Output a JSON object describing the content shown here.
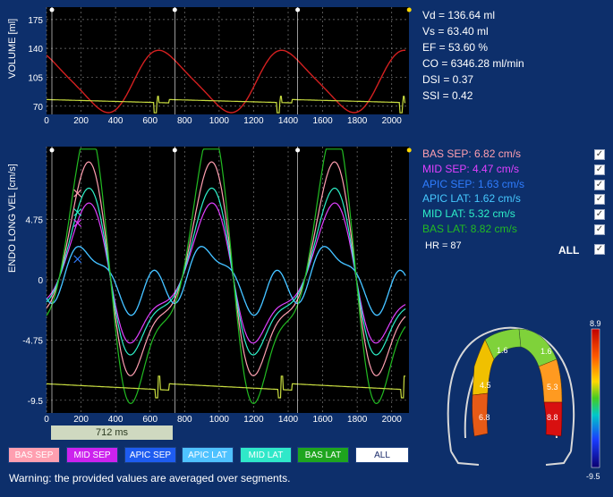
{
  "volume_panel": {
    "ylabel": "VOLUME [ml]",
    "y_ticks": [
      "175",
      "140",
      "105",
      "70"
    ],
    "x_ticks": [
      "0",
      "200",
      "400",
      "600",
      "800",
      "1000",
      "1200",
      "1400",
      "1600",
      "1800",
      "2000"
    ]
  },
  "velocity_panel": {
    "ylabel": "ENDO LONG VEL [cm/s]",
    "y_ticks": [
      "4.75",
      "0",
      "-4.75",
      "-9.5"
    ],
    "x_ticks": [
      "0",
      "200",
      "400",
      "600",
      "800",
      "1000",
      "1200",
      "1400",
      "1600",
      "1800",
      "2000"
    ],
    "duration_label": "712 ms"
  },
  "stats": {
    "vd": "Vd = 136.64 ml",
    "vs": "Vs = 63.40 ml",
    "ef": "EF = 53.60 %",
    "co": "CO = 6346.28 ml/min",
    "dsi": "DSI = 0.37",
    "ssi": "SSI = 0.42"
  },
  "segments": [
    {
      "label": "BAS SEP: 6.82  cm/s",
      "color": "#ff9fb0",
      "btn": "BAS SEP",
      "btn_bg": "#ff9fb0",
      "btn_fg": "#ffffff"
    },
    {
      "label": "MID SEP: 4.47  cm/s",
      "color": "#e040ff",
      "btn": "MID SEP",
      "btn_bg": "#cc22ee",
      "btn_fg": "#ffffff"
    },
    {
      "label": "APIC SEP: 1.63  cm/s",
      "color": "#2f7dff",
      "btn": "APIC SEP",
      "btn_bg": "#1e5cf0",
      "btn_fg": "#ffffff"
    },
    {
      "label": "APIC LAT: 1.62  cm/s",
      "color": "#46c8ff",
      "btn": "APIC LAT",
      "btn_bg": "#4fc2ff",
      "btn_fg": "#ffffff"
    },
    {
      "label": "MID LAT: 5.32  cm/s",
      "color": "#2ef0c8",
      "btn": "MID LAT",
      "btn_bg": "#2fe8c9",
      "btn_fg": "#ffffff"
    },
    {
      "label": "BAS LAT: 8.82  cm/s",
      "color": "#22bb22",
      "btn": "BAS LAT",
      "btn_bg": "#1ea51e",
      "btn_fg": "#ffffff"
    }
  ],
  "all_button": "ALL",
  "hr": "HR = 87",
  "all_toggle_label": "ALL",
  "color_scale": {
    "max": "8.9",
    "min": "-9.5"
  },
  "heart_values": {
    "apic_sep": "1.6",
    "apic_lat": "1.6",
    "mid_sep": "4.5",
    "mid_lat": "5.3",
    "bas_sep": "6.8",
    "bas_lat": "8.8"
  },
  "warning": "Warning: the provided values are averaged over segments.",
  "chart_data": [
    {
      "type": "line",
      "ylabel": "VOLUME [ml]",
      "xlim": [
        0,
        2100
      ],
      "ylim": [
        60,
        190
      ],
      "y_ticks": [
        70,
        105,
        140,
        175
      ],
      "x_ticks": [
        0,
        200,
        400,
        600,
        800,
        1000,
        1200,
        1400,
        1600,
        1800,
        2000
      ],
      "series": [
        {
          "color": "#d42020",
          "x": [
            0,
            100,
            200,
            300,
            350,
            400,
            500,
            600,
            650,
            700,
            800,
            900,
            1000,
            1050,
            1100,
            1200,
            1300,
            1400,
            1450,
            1500,
            1600,
            1700,
            1750,
            1800,
            1900,
            2000,
            2050,
            2080
          ],
          "y": [
            120,
            136,
            125,
            85,
            63,
            70,
            98,
            122,
            134,
            125,
            88,
            64,
            70,
            99,
            123,
            135,
            126,
            88,
            64,
            70,
            98,
            123,
            135,
            125,
            88,
            64,
            75,
            95
          ]
        }
      ]
    },
    {
      "type": "line",
      "ylabel": "ENDO LONG VEL [cm/s]",
      "xlim": [
        0,
        2100
      ],
      "ylim": [
        -10.5,
        10.5
      ],
      "y_ticks": [
        -9.5,
        -4.75,
        0,
        4.75
      ],
      "x_ticks": [
        0,
        200,
        400,
        600,
        800,
        1000,
        1200,
        1400,
        1600,
        1800,
        2000
      ],
      "series": [
        {
          "name": "BAS SEP",
          "peak": 6.82
        },
        {
          "name": "MID SEP",
          "peak": 4.47
        },
        {
          "name": "APIC SEP",
          "peak": 1.63
        },
        {
          "name": "APIC LAT",
          "peak": 1.62
        },
        {
          "name": "MID LAT",
          "peak": 5.32
        },
        {
          "name": "BAS LAT",
          "peak": 8.82
        }
      ]
    }
  ]
}
